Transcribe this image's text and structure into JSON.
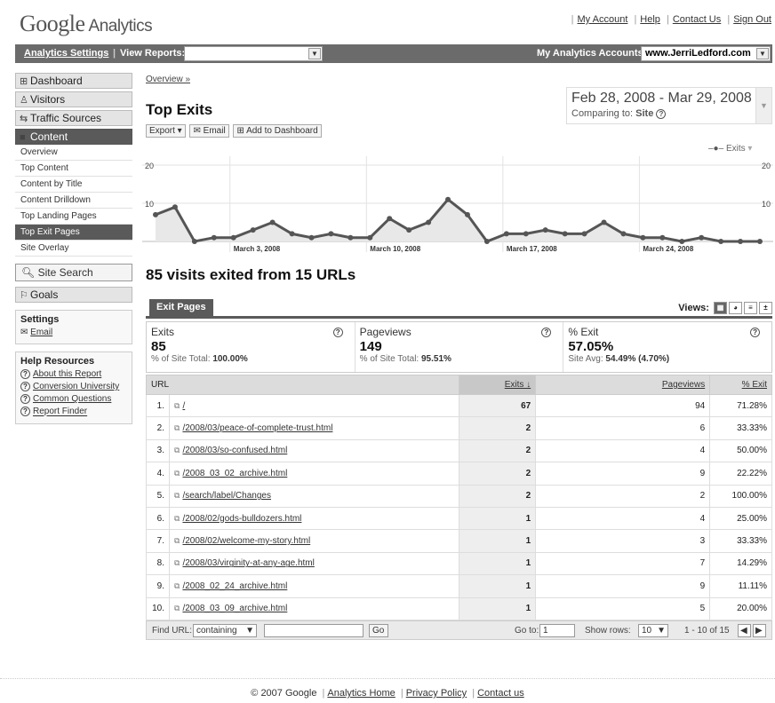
{
  "header": {
    "logo_main": "Google",
    "logo_sub": "Analytics",
    "links": [
      "My Account",
      "Help",
      "Contact Us",
      "Sign Out"
    ]
  },
  "navbar": {
    "settings": "Analytics Settings",
    "view_reports": "View Reports:",
    "accounts_label": "My Analytics Accounts:",
    "account_value": "www.JerriLedford.com"
  },
  "sidebar": {
    "main_items": [
      "Dashboard",
      "Visitors",
      "Traffic Sources",
      "Content"
    ],
    "content_subitems": [
      "Overview",
      "Top Content",
      "Content by Title",
      "Content Drilldown",
      "Top Landing Pages",
      "Top Exit Pages",
      "Site Overlay"
    ],
    "site_search": "Site Search",
    "goals": "Goals",
    "settings_title": "Settings",
    "settings_email": "Email",
    "help_title": "Help Resources",
    "help_links": [
      "About this Report",
      "Conversion University",
      "Common Questions",
      "Report Finder"
    ]
  },
  "main": {
    "breadcrumb": "Overview »",
    "title": "Top Exits",
    "toolbar": [
      "Export ▾",
      "Email",
      "Add to Dashboard"
    ],
    "date_range": "Feb 28, 2008 - Mar 29, 2008",
    "comparing_label": "Comparing to:",
    "comparing_value": "Site",
    "legend": "Exits",
    "summary": "85 visits exited from 15 URLs",
    "tab": "Exit Pages",
    "views_label": "Views:"
  },
  "chart_data": {
    "type": "line",
    "series": [
      {
        "name": "Exits",
        "values": [
          7,
          9,
          0,
          1,
          1,
          3,
          5,
          2,
          1,
          2,
          1,
          1,
          6,
          3,
          5,
          11,
          7,
          0,
          2,
          2,
          3,
          2,
          2,
          5,
          2,
          1,
          1,
          0,
          1,
          0,
          0,
          0
        ]
      }
    ],
    "ylim": [
      0,
      20
    ],
    "y_ticks": [
      "20",
      "10"
    ],
    "x_tick_labels": [
      "March 3, 2008",
      "March 10, 2008",
      "March 17, 2008",
      "March 24, 2008"
    ],
    "colors": {
      "line": "#555555",
      "fill": "#e8e8e8"
    }
  },
  "scorecards": [
    {
      "label": "Exits",
      "value": "85",
      "sub_label": "% of Site Total:",
      "sub_value": "100.00%"
    },
    {
      "label": "Pageviews",
      "value": "149",
      "sub_label": "% of Site Total:",
      "sub_value": "95.51%"
    },
    {
      "label": "% Exit",
      "value": "57.05%",
      "sub_label": "Site Avg:",
      "sub_value": "54.49% (4.70%)"
    }
  ],
  "table": {
    "columns": [
      "URL",
      "Exits ↓",
      "Pageviews",
      "% Exit"
    ],
    "rows": [
      {
        "idx": "1.",
        "url": "/",
        "exits": "67",
        "pageviews": "94",
        "pct": "71.28%"
      },
      {
        "idx": "2.",
        "url": "/2008/03/peace-of-complete-trust.html",
        "exits": "2",
        "pageviews": "6",
        "pct": "33.33%"
      },
      {
        "idx": "3.",
        "url": "/2008/03/so-confused.html",
        "exits": "2",
        "pageviews": "4",
        "pct": "50.00%"
      },
      {
        "idx": "4.",
        "url": "/2008_03_02_archive.html",
        "exits": "2",
        "pageviews": "9",
        "pct": "22.22%"
      },
      {
        "idx": "5.",
        "url": "/search/label/Changes",
        "exits": "2",
        "pageviews": "2",
        "pct": "100.00%"
      },
      {
        "idx": "6.",
        "url": "/2008/02/gods-bulldozers.html",
        "exits": "1",
        "pageviews": "4",
        "pct": "25.00%"
      },
      {
        "idx": "7.",
        "url": "/2008/02/welcome-my-story.html",
        "exits": "1",
        "pageviews": "3",
        "pct": "33.33%"
      },
      {
        "idx": "8.",
        "url": "/2008/03/virginity-at-any-age.html",
        "exits": "1",
        "pageviews": "7",
        "pct": "14.29%"
      },
      {
        "idx": "9.",
        "url": "/2008_02_24_archive.html",
        "exits": "1",
        "pageviews": "9",
        "pct": "11.11%"
      },
      {
        "idx": "10.",
        "url": "/2008_03_09_archive.html",
        "exits": "1",
        "pageviews": "5",
        "pct": "20.00%"
      }
    ]
  },
  "table_footer": {
    "find_url": "Find URL:",
    "match": "containing",
    "go": "Go",
    "goto_label": "Go to:",
    "goto_value": "1",
    "show_rows_label": "Show rows:",
    "show_rows_value": "10",
    "range": "1 - 10 of 15"
  },
  "footer": {
    "copyright": "© 2007 Google",
    "links": [
      "Analytics Home",
      "Privacy Policy",
      "Contact us"
    ]
  }
}
